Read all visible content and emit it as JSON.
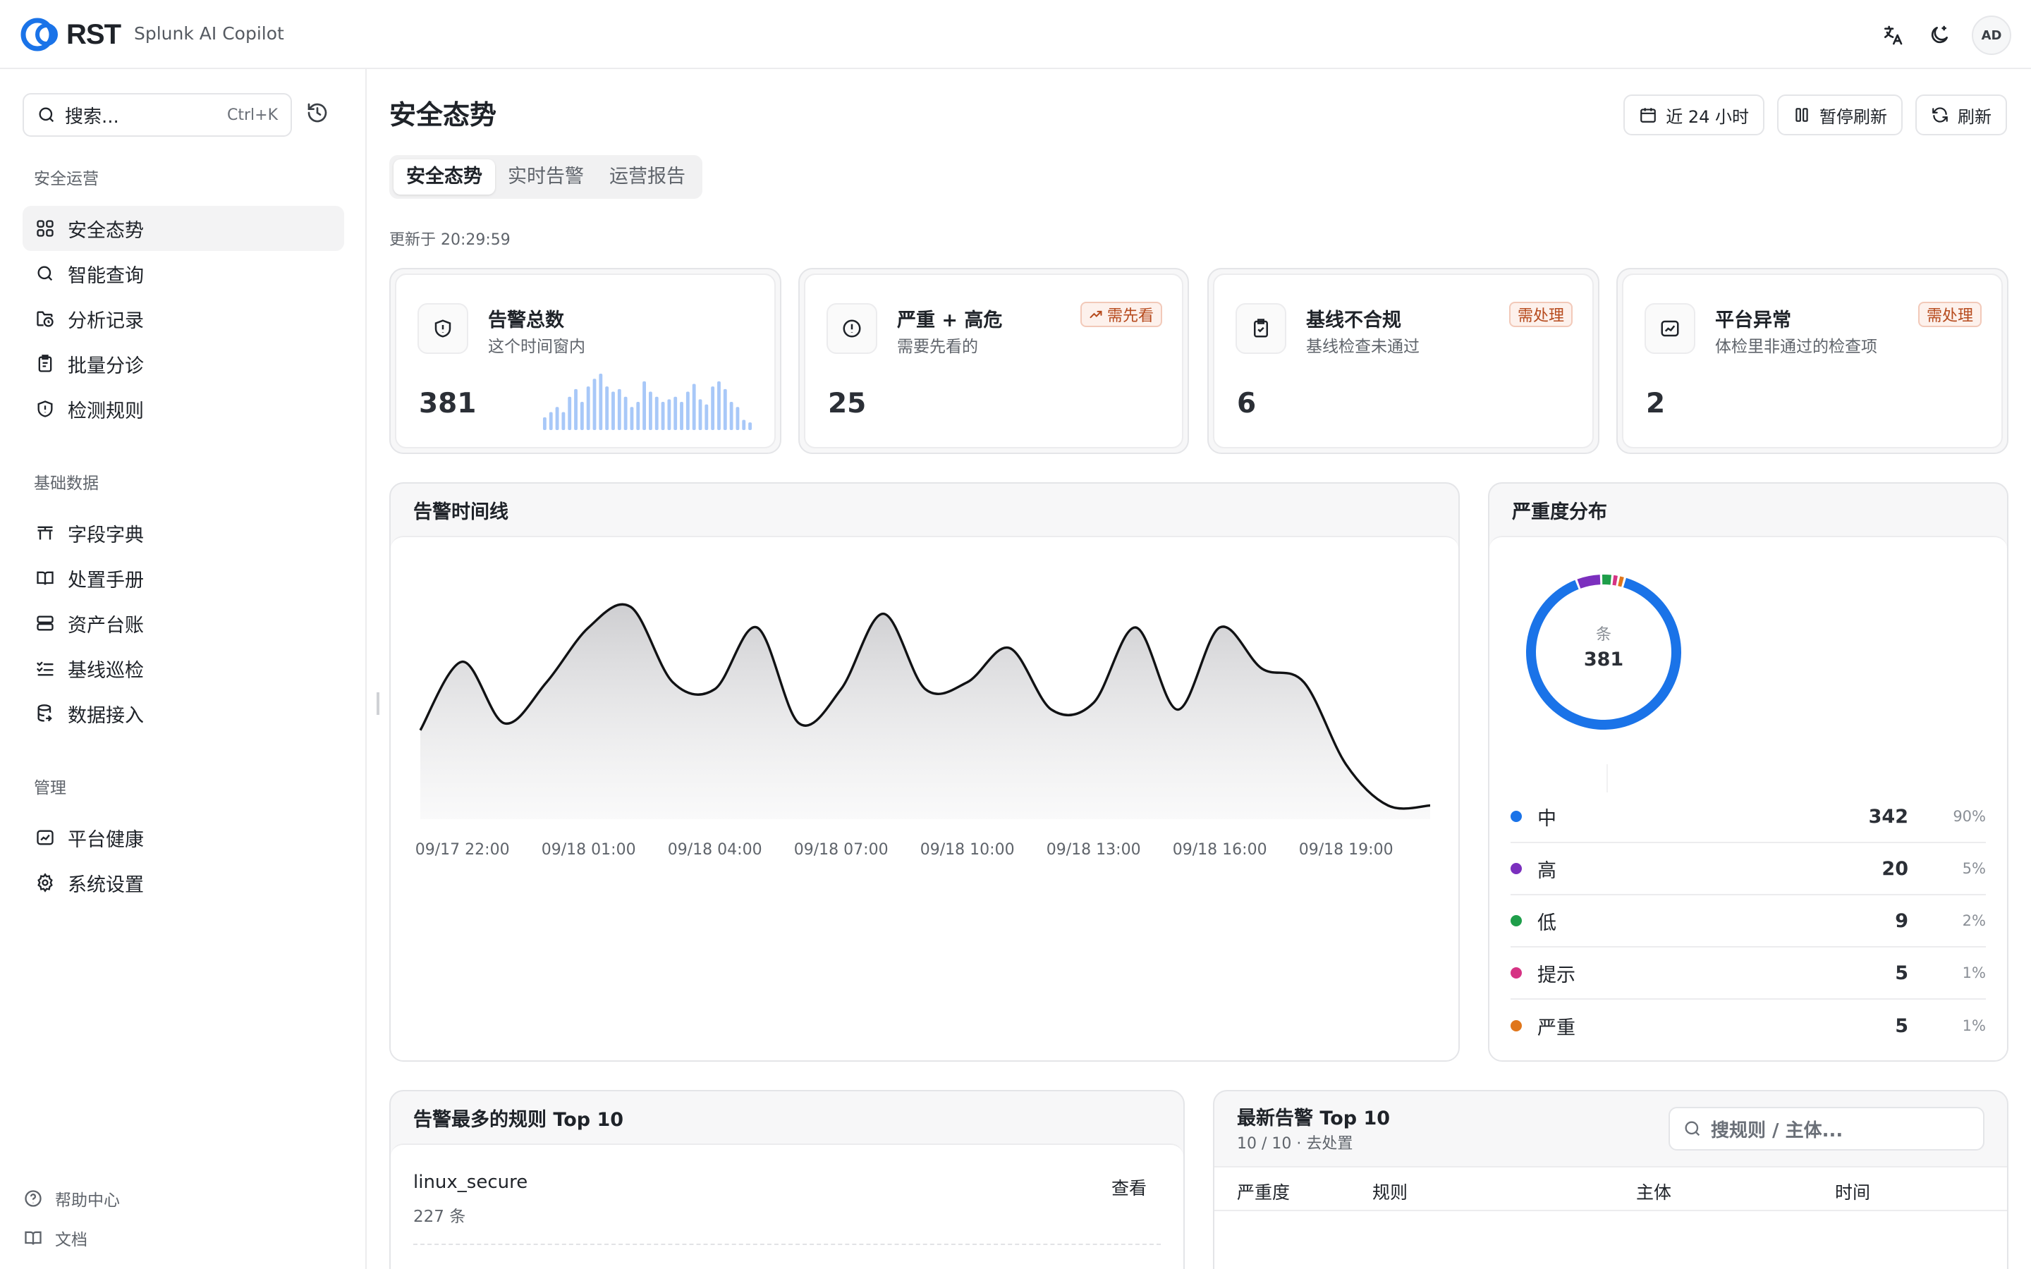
{
  "topbar": {
    "logo_text": "RST",
    "app_name": "Splunk AI Copilot",
    "avatar_initials": "AD",
    "icons": [
      "translate-icon",
      "theme-toggle-icon"
    ]
  },
  "sidebar": {
    "search_placeholder": "搜索...",
    "search_shortcut": "Ctrl+K",
    "groups": [
      {
        "title": "安全运营",
        "items": [
          {
            "label": "安全态势",
            "icon": "grid-icon",
            "active": true
          },
          {
            "label": "智能查询",
            "icon": "search-icon"
          },
          {
            "label": "分析记录",
            "icon": "folder-clock-icon"
          },
          {
            "label": "批量分诊",
            "icon": "clipboard-list-icon"
          },
          {
            "label": "检测规则",
            "icon": "shield-alert-icon"
          }
        ]
      },
      {
        "title": "基础数据",
        "items": [
          {
            "label": "字段字典",
            "icon": "table-icon"
          },
          {
            "label": "处置手册",
            "icon": "book-icon"
          },
          {
            "label": "资产台账",
            "icon": "server-icon"
          },
          {
            "label": "基线巡检",
            "icon": "list-check-icon"
          },
          {
            "label": "数据接入",
            "icon": "database-icon"
          }
        ]
      },
      {
        "title": "管理",
        "items": [
          {
            "label": "平台健康",
            "icon": "health-chart-icon"
          },
          {
            "label": "系统设置",
            "icon": "gear-icon"
          }
        ]
      }
    ],
    "footer": [
      {
        "label": "帮助中心",
        "icon": "help-circle-icon"
      },
      {
        "label": "文档",
        "icon": "book-open-icon"
      }
    ]
  },
  "main": {
    "title": "安全态势",
    "buttons": {
      "range": "近 24 小时",
      "pause": "暂停刷新",
      "refresh": "刷新"
    },
    "tabs": [
      "安全态势",
      "实时告警",
      "运营报告"
    ],
    "updated": "更新于 20:29:59",
    "cards": [
      {
        "title": "告警总数",
        "sub": "这个时间窗内",
        "value": "381",
        "icon": "shield-alert-icon",
        "badge": ""
      },
      {
        "title": "严重 + 高危",
        "sub": "需要先看的",
        "value": "25",
        "icon": "alert-circle-icon",
        "badge": "需先看"
      },
      {
        "title": "基线不合规",
        "sub": "基线检查未通过",
        "value": "6",
        "icon": "clipboard-check-icon",
        "badge": "需处理"
      },
      {
        "title": "平台异常",
        "sub": "体检里非通过的检查项",
        "value": "2",
        "icon": "activity-icon",
        "badge": "需处理"
      }
    ],
    "timeline_title": "告警时间线",
    "severity_title": "严重度分布",
    "donut_unit": "条",
    "donut_total": "381",
    "top_rules_title": "告警最多的规则 Top 10",
    "top_rule": {
      "name": "linux_secure",
      "count": "227 条",
      "action": "查看"
    },
    "latest": {
      "title": "最新告警 Top 10",
      "sub": "10 / 10 · 去处置",
      "search_placeholder": "搜规则 / 主体...",
      "columns": [
        "严重度",
        "规则",
        "主体",
        "时间"
      ]
    }
  },
  "colors": {
    "medium": "#1a73e8",
    "high": "#7b2fbe",
    "low": "#1e9e4a",
    "info": "#d63384",
    "critical": "#e0761b",
    "badge_text": "#b64a1d",
    "sparkbar": "#a8c8f8"
  },
  "chart_data": [
    {
      "type": "bar",
      "categories": [],
      "values": [
        10,
        14,
        18,
        14,
        26,
        32,
        22,
        34,
        40,
        44,
        34,
        30,
        32,
        26,
        18,
        22,
        38,
        30,
        26,
        22,
        24,
        26,
        22,
        30,
        36,
        24,
        20,
        34,
        38,
        32,
        22,
        18,
        8,
        6
      ],
      "title": "",
      "xlabel": "",
      "ylabel": ""
    },
    {
      "type": "area",
      "x": [
        "09/17 21:00",
        "09/17 22:00",
        "09/17 23:00",
        "09/18 00:00",
        "09/18 01:00",
        "09/18 02:00",
        "09/18 03:00",
        "09/18 04:00",
        "09/18 05:00",
        "09/18 06:00",
        "09/18 07:00",
        "09/18 08:00",
        "09/18 09:00",
        "09/18 10:00",
        "09/18 11:00",
        "09/18 12:00",
        "09/18 13:00",
        "09/18 14:00",
        "09/18 15:00",
        "09/18 16:00",
        "09/18 17:00",
        "09/18 18:00",
        "09/18 19:00",
        "09/18 20:00",
        "09/18 21:00"
      ],
      "x_ticks": [
        "09/17 22:00",
        "09/18 01:00",
        "09/18 04:00",
        "09/18 07:00",
        "09/18 10:00",
        "09/18 13:00",
        "09/18 16:00",
        "09/18 19:00"
      ],
      "series": [
        {
          "values": [
            13,
            23,
            14,
            20,
            28,
            31,
            20,
            19,
            28,
            14,
            19,
            30,
            19,
            20,
            25,
            16,
            17,
            28,
            16,
            28,
            22,
            20,
            8,
            2,
            2
          ]
        }
      ],
      "ylim": [
        0,
        35
      ],
      "grid": false,
      "title": ""
    },
    {
      "type": "pie",
      "categories": [
        "中",
        "高",
        "低",
        "提示",
        "严重"
      ],
      "values": [
        342,
        20,
        9,
        5,
        5
      ],
      "percent_labels": [
        "90%",
        "5%",
        "2%",
        "1%",
        "1%"
      ],
      "colors": [
        "#1a73e8",
        "#7b2fbe",
        "#1e9e4a",
        "#d63384",
        "#e0761b"
      ],
      "center_label": "条",
      "center_value": "381"
    }
  ]
}
